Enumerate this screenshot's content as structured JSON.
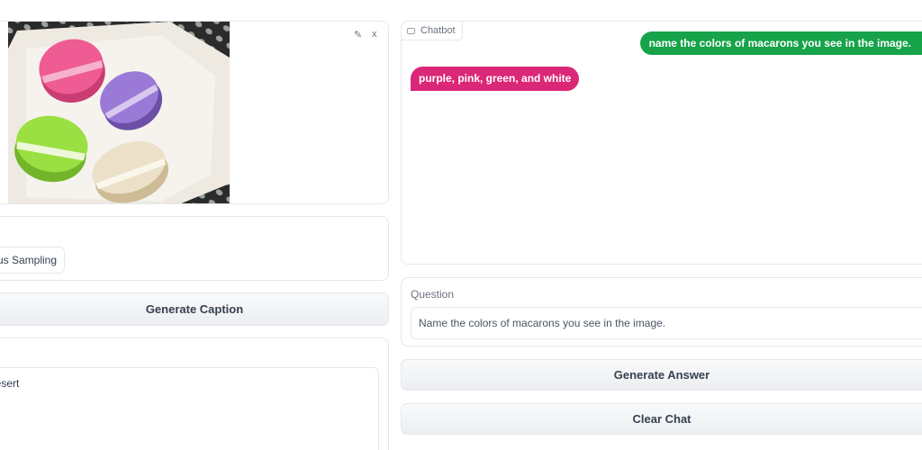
{
  "image_panel": {
    "edit_icon": "pencil-icon",
    "close_icon": "close-icon",
    "edit_glyph": "✎",
    "close_glyph": "x",
    "colors": {
      "pink": "#e94e88",
      "purple": "#8d6bc7",
      "green": "#8fd63a",
      "cream": "#e6d8b8"
    }
  },
  "decoding": {
    "option_label": "Nucleus Sampling"
  },
  "generate_caption_label": "Generate Caption",
  "caption_output": "desert",
  "chatbot": {
    "label": "Chatbot",
    "messages": [
      {
        "role": "user",
        "text": "name the colors of macarons you see in the image."
      },
      {
        "role": "bot",
        "text": "purple, pink, green, and white"
      }
    ],
    "user_color": "#16a34a",
    "bot_color": "#db2777"
  },
  "question": {
    "label": "Question",
    "value": "Name the colors of macarons you see in the image."
  },
  "generate_answer_label": "Generate Answer",
  "clear_chat_label": "Clear Chat"
}
